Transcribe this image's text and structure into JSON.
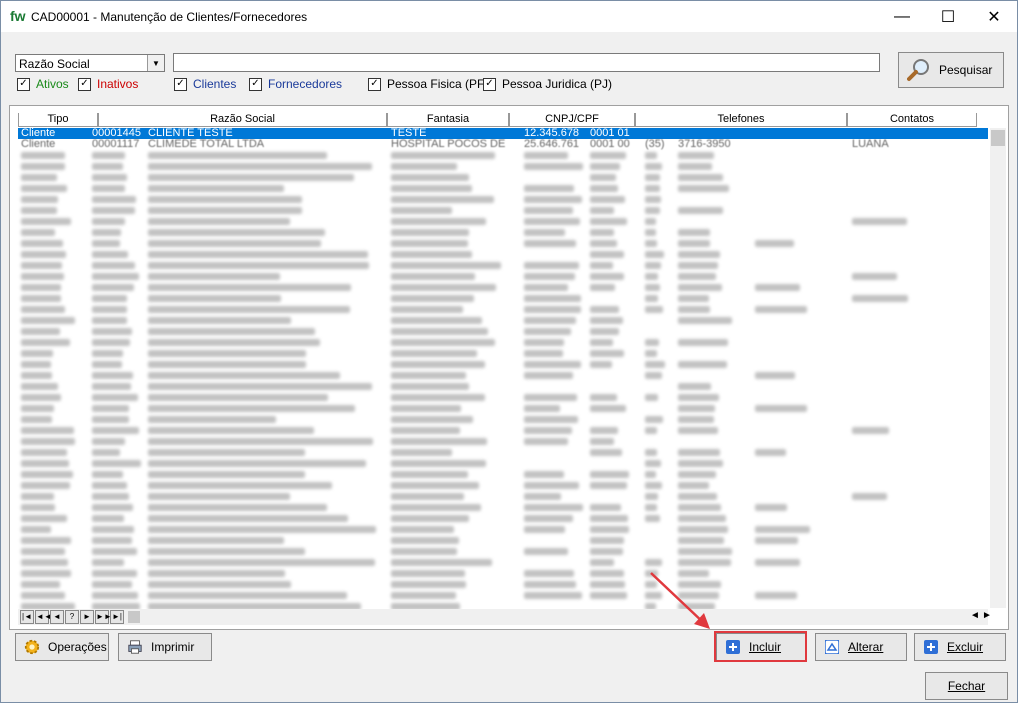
{
  "window": {
    "logo": "fw",
    "title": "CAD00001 - Manutenção de Clientes/Fornecedores",
    "minimize": "—",
    "maximize": "☐",
    "close": "✕"
  },
  "search": {
    "field_selected": "Razão Social",
    "value": "",
    "button_label": "Pesquisar"
  },
  "filters": [
    {
      "label": "Ativos",
      "checked": true,
      "color": "#1a8a1a"
    },
    {
      "label": "Inativos",
      "checked": true,
      "color": "#cc0000"
    },
    {
      "label": "Clientes",
      "checked": true,
      "color": "#1a3a9a"
    },
    {
      "label": "Fornecedores",
      "checked": true,
      "color": "#1a3a9a"
    },
    {
      "label": "Pessoa Fisica (PF)",
      "checked": true,
      "color": "#000000"
    },
    {
      "label": "Pessoa Juridica (PJ)",
      "checked": true,
      "color": "#000000"
    }
  ],
  "grid": {
    "columns": [
      "Tipo",
      "Razão Social",
      "Fantasia",
      "CNPJ/CPF",
      "Telefones",
      "Contatos"
    ],
    "rows": [
      {
        "tipo": "Cliente",
        "codigo": "00001445",
        "razao": "CLIENTE TESTE",
        "fantasia": "TESTE",
        "cnpj": "12.345.678",
        "cnpj2": "0001 01",
        "tel": "",
        "contatos": ""
      },
      {
        "tipo": "Cliente",
        "codigo": "00001117",
        "razao": "CLIMEDE TOTAL LTDA",
        "fantasia": "HOSPITAL POCOS DE",
        "cnpj": "25.646.761",
        "cnpj2": "0001 00",
        "tel": "(35)",
        "tel2": "3716-3950",
        "contatos": "LUANA"
      }
    ],
    "nav_buttons": [
      "|◄",
      "◄◄",
      "◄",
      "?",
      "►",
      "►►",
      "►|"
    ]
  },
  "buttons": {
    "operacoes": "Operações",
    "imprimir": "Imprimir",
    "incluir": "Incluir",
    "alterar": "Alterar",
    "excluir": "Excluir",
    "fechar": "Fechar"
  },
  "colors": {
    "selection": "#0078d7",
    "annotation": "#e0393e"
  }
}
